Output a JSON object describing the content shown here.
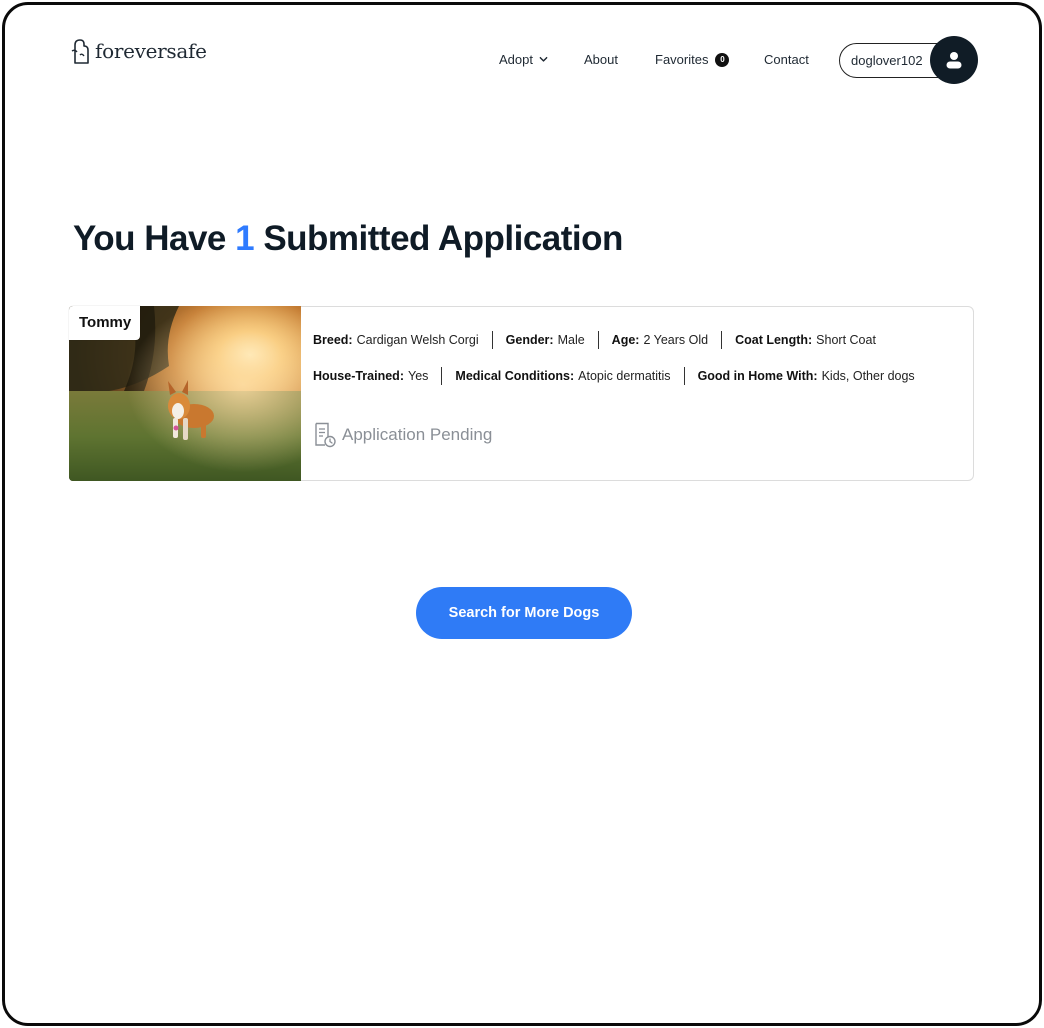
{
  "brand": {
    "name": "foreversafe"
  },
  "nav": {
    "adopt": "Adopt",
    "about": "About",
    "favorites": "Favorites",
    "favorites_count": "0",
    "contact": "Contact",
    "username": "doglover102"
  },
  "page": {
    "title_prefix": "You Have ",
    "title_count": "1",
    "title_suffix": " Submitted Application"
  },
  "application": {
    "dog_name": "Tommy",
    "attributes_row1": [
      {
        "label": "Breed:",
        "value": "Cardigan Welsh Corgi"
      },
      {
        "label": "Gender:",
        "value": "Male"
      },
      {
        "label": "Age:",
        "value": "2 Years Old"
      },
      {
        "label": "Coat Length:",
        "value": "Short Coat"
      }
    ],
    "attributes_row2": [
      {
        "label": "House-Trained:",
        "value": "Yes"
      },
      {
        "label": "Medical Conditions:",
        "value": "Atopic dermatitis"
      },
      {
        "label": "Good in Home With:",
        "value": "Kids, Other dogs"
      }
    ],
    "status": "Application Pending",
    "status_icon": "document-clock-icon"
  },
  "actions": {
    "search_more": "Search for More Dogs"
  },
  "colors": {
    "accent": "#2f7bf6",
    "dark": "#101c26",
    "muted": "#8a8f96"
  }
}
